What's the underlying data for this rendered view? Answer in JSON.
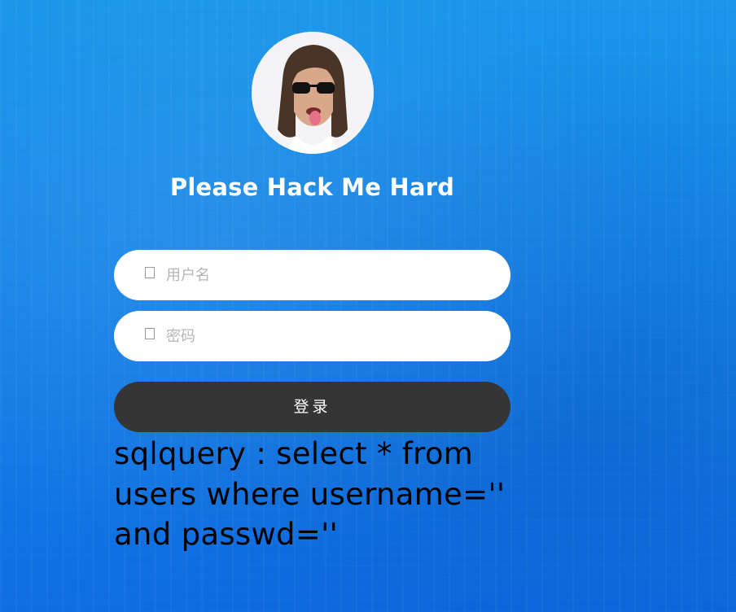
{
  "page": {
    "title": "Please Hack Me Hard"
  },
  "form": {
    "username_placeholder": "用户名",
    "password_placeholder": "密码",
    "login_label": "登录",
    "username_icon": "user-icon",
    "password_icon": "lock-icon"
  },
  "debug": {
    "sqlquery": "sqlquery : select * from users where username='' and passwd=''"
  },
  "colors": {
    "background_top": "#1a96ea",
    "background_bottom": "#0e6de2",
    "button": "#353535",
    "input_bg": "#ffffff"
  }
}
